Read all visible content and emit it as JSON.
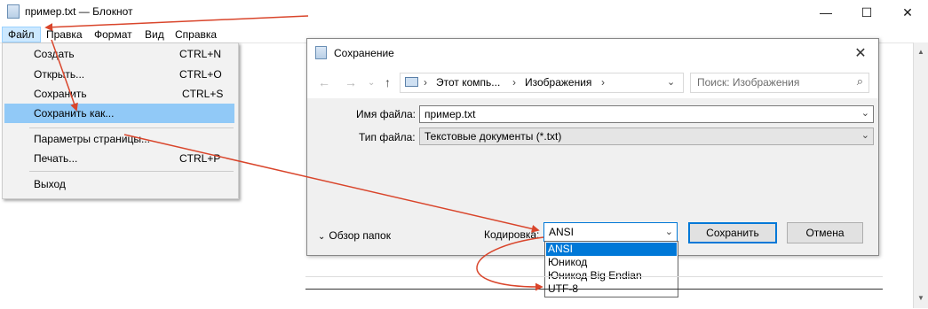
{
  "notepad": {
    "title": "пример.txt — Блокнот",
    "caption_buttons": [
      "—",
      "☐",
      "✕"
    ],
    "menu": [
      "Файл",
      "Правка",
      "Формат",
      "Вид",
      "Справка"
    ]
  },
  "file_menu": {
    "items": [
      {
        "label": "Создать",
        "shortcut": "CTRL+N"
      },
      {
        "label": "Открыть...",
        "shortcut": "CTRL+O"
      },
      {
        "label": "Сохранить",
        "shortcut": "CTRL+S"
      },
      {
        "label": "Сохранить как...",
        "shortcut": ""
      },
      {
        "label": "Параметры страницы...",
        "shortcut": ""
      },
      {
        "label": "Печать...",
        "shortcut": "CTRL+P"
      },
      {
        "label": "Выход",
        "shortcut": ""
      }
    ]
  },
  "dialog": {
    "title": "Сохранение",
    "close": "✕",
    "breadcrumb": [
      "Этот компь...",
      "Изображения"
    ],
    "search_placeholder": "Поиск: Изображения",
    "filename_label": "Имя файла:",
    "filename_value": "пример.txt",
    "filetype_label": "Тип файла:",
    "filetype_value": "Текстовые документы (*.txt)",
    "browse_folders": "Обзор папок",
    "encoding_label": "Кодировка:",
    "encoding_value": "ANSI",
    "encoding_options": [
      "ANSI",
      "Юникод",
      "Юникод Big Endian",
      "UTF-8"
    ],
    "save_button": "Сохранить",
    "cancel_button": "Отмена"
  },
  "colors": {
    "highlight": "#91c9f7",
    "selection": "#0078d7",
    "annotation_arrow": "#d9452b"
  }
}
